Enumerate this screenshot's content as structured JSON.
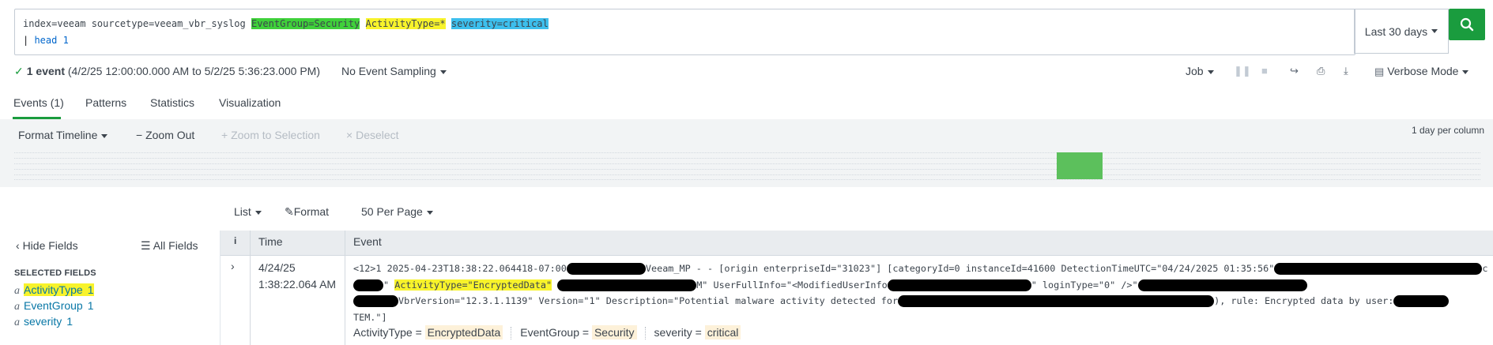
{
  "search": {
    "query_line1_plain": "index=veeam sourcetype=veeam_vbr_syslog ",
    "query_hl_green": "EventGroup=Security",
    "query_hl_yellow": "ActivityType=*",
    "query_hl_blue": "severity=critical",
    "query_line2_pipe": "| ",
    "query_line2_cmd": "head 1",
    "time_range": "Last 30 days",
    "button_icon": "search-icon"
  },
  "status": {
    "count": "1 event",
    "range": "(4/2/25 12:00:00.000 AM to 5/2/25 5:36:23.000 PM)",
    "sampling": "No Event Sampling",
    "job_label": "Job",
    "mode": "Verbose Mode"
  },
  "tabs": [
    {
      "label": "Events (1)"
    },
    {
      "label": "Patterns"
    },
    {
      "label": "Statistics"
    },
    {
      "label": "Visualization"
    }
  ],
  "timeline": {
    "format": "Format Timeline",
    "zoom_out": "Zoom Out",
    "zoom_sel": "Zoom to Selection",
    "deselect": "Deselect",
    "scale": "1 day per column"
  },
  "list_controls": {
    "list": "List",
    "format": "Format",
    "per_page": "50 Per Page"
  },
  "sidebar": {
    "hide": "Hide Fields",
    "all": "All Fields",
    "heading": "SELECTED FIELDS",
    "fields": [
      {
        "type": "a",
        "name": "ActivityType",
        "count": "1"
      },
      {
        "type": "a",
        "name": "EventGroup",
        "count": "1"
      },
      {
        "type": "a",
        "name": "severity",
        "count": "1"
      }
    ]
  },
  "table": {
    "col_info": "i",
    "col_time": "Time",
    "col_event": "Event",
    "time_date": "4/24/25",
    "time_clock": "1:38:22.064 AM",
    "ev_l1_a": "<12>1 2025-04-23T18:38:22.064418-07:00",
    "ev_l1_b": "Veeam_MP - - [origin enterpriseId=\"31023\"] [categoryId=0 instanceId=41600 DetectionTimeUTC=\"04/24/2025 01:35:56\"",
    "ev_l1_c": "c",
    "ev_l2_a": "\" ",
    "ev_l2_hl": "ActivityType=\"EncryptedData\"",
    "ev_l2_b": "M\" UserFullInfo=\"<ModifiedUserInfo",
    "ev_l2_c": "\" loginType=\"0\" />\"",
    "ev_l3_a": "VbrVersion=\"12.3.1.1139\" Version=\"1\" Description=\"Potential malware activity detected for",
    "ev_l3_b": "), rule: Encrypted data by user:",
    "ev_l4": "TEM.\"]",
    "fields": [
      {
        "key": "ActivityType",
        "value": "EncryptedData"
      },
      {
        "key": "EventGroup",
        "value": "Security"
      },
      {
        "key": "severity",
        "value": "critical"
      }
    ]
  },
  "colors": {
    "accent_green": "#1a9c3e",
    "highlight_yellow": "#f8f32b",
    "highlight_green": "#3fd13a",
    "highlight_blue": "#3dbfed",
    "link_blue": "#0877a6"
  }
}
